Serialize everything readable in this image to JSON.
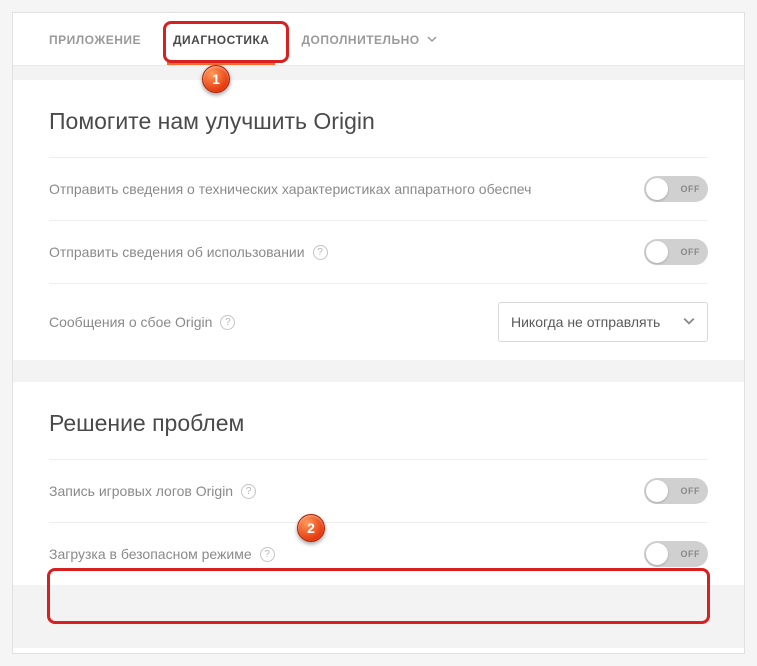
{
  "tabs": {
    "app": "ПРИЛОЖЕНИЕ",
    "diag": "ДИАГНОСТИКА",
    "more": "ДОПОЛНИТЕЛЬНО"
  },
  "sections": {
    "improve": {
      "title": "Помогите нам улучшить Origin",
      "hw_label": "Отправить сведения о технических характеристиках аппаратного обеспеч",
      "hw_toggle": "OFF",
      "usage_label": "Отправить сведения об использовании",
      "usage_toggle": "OFF",
      "crash_label": "Сообщения о сбое Origin",
      "crash_select": "Никогда не отправлять"
    },
    "troubleshoot": {
      "title": "Решение проблем",
      "logs_label": "Запись игровых логов Origin",
      "logs_toggle": "OFF",
      "safemode_label": "Загрузка в безопасном режиме",
      "safemode_toggle": "OFF"
    }
  },
  "callouts": {
    "c1": "1",
    "c2": "2"
  }
}
